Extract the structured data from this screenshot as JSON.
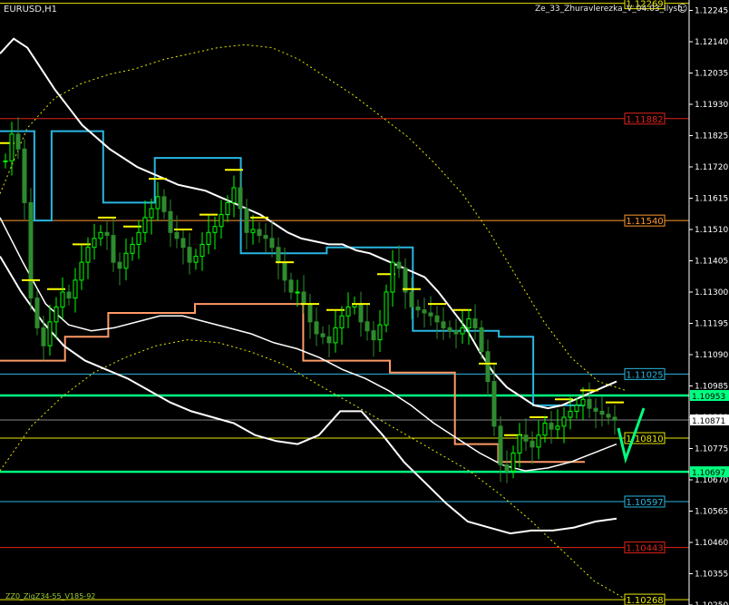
{
  "window": {
    "symbol_label": "EURUSD,H1",
    "indicator_label": "Ze_33_Zhuravlerezka_V_04.03_Ilysh",
    "smiley": "☺",
    "bottom_label": "ZZ0_ZigZ34-55_V185-92"
  },
  "colors": {
    "background": "#000000",
    "candle_up": "#00ff00",
    "candle_down": "#2e8b2e",
    "white_band": "#ffffff",
    "yellow_dash": "#e6e600",
    "cyan_step": "#29b6e0",
    "orange_step": "#ff9966",
    "yellow_bars": "#ffff00",
    "green_level": "#00ff80",
    "red_level": "#e0241a",
    "orange_level": "#ff9a2e",
    "blue_level": "#2f8fd8",
    "axis": "#ffffff"
  },
  "chart_data": {
    "type": "line",
    "title": "EURUSD,H1",
    "ylim": [
      1.1025,
      1.1228
    ],
    "y_ticks": [
      1.12245,
      1.1214,
      1.12035,
      1.1193,
      1.11825,
      1.1172,
      1.11615,
      1.1151,
      1.11405,
      1.113,
      1.11195,
      1.1109,
      1.10985,
      1.1088,
      1.10775,
      1.1067,
      1.10565,
      1.1046,
      1.10355,
      1.1025
    ],
    "current_price": 1.10871,
    "levels": [
      {
        "price": 1.12269,
        "color": "#e6e600",
        "label": "1.12269",
        "labeled": true
      },
      {
        "price": 1.11882,
        "color": "#e0241a",
        "label": "1.11882",
        "labeled": true
      },
      {
        "price": 1.1154,
        "color": "#ff9a2e",
        "label": "1.11540",
        "labeled": true
      },
      {
        "price": 1.11025,
        "color": "#29b6e0",
        "label": "1.11025",
        "labeled": true
      },
      {
        "price": 1.1081,
        "color": "#e6e600",
        "label": "1.10810",
        "labeled": true
      },
      {
        "price": 1.10597,
        "color": "#29b6e0",
        "label": "1.10597",
        "labeled": true
      },
      {
        "price": 1.10443,
        "color": "#e0241a",
        "label": "1.10443",
        "labeled": true
      },
      {
        "price": 1.10268,
        "color": "#e6e600",
        "label": "1.10268",
        "labeled": true
      },
      {
        "price": 1.10953,
        "color": "#00ff80",
        "label": "1.10953",
        "labeled": false,
        "axis_tag": true
      },
      {
        "price": 1.10697,
        "color": "#00ff80",
        "label": "1.10697",
        "labeled": false,
        "axis_tag": true
      }
    ],
    "candles_close": [
      1.1174,
      1.1183,
      1.1178,
      1.116,
      1.1128,
      1.1118,
      1.1112,
      1.112,
      1.1125,
      1.113,
      1.1128,
      1.1134,
      1.114,
      1.1145,
      1.1148,
      1.115,
      1.1149,
      1.114,
      1.1138,
      1.1143,
      1.1146,
      1.115,
      1.1155,
      1.1158,
      1.1162,
      1.1157,
      1.115,
      1.1148,
      1.1145,
      1.114,
      1.1142,
      1.1146,
      1.115,
      1.1152,
      1.1156,
      1.116,
      1.1165,
      1.1158,
      1.115,
      1.1151,
      1.1149,
      1.1148,
      1.1145,
      1.114,
      1.1134,
      1.113,
      1.113,
      1.1126,
      1.112,
      1.1116,
      1.1115,
      1.1113,
      1.1118,
      1.1122,
      1.1125,
      1.1126,
      1.112,
      1.1117,
      1.1114,
      1.1119,
      1.113,
      1.114,
      1.1138,
      1.113,
      1.1125,
      1.1124,
      1.1123,
      1.1122,
      1.112,
      1.1118,
      1.1117,
      1.1116,
      1.1118,
      1.1121,
      1.1118,
      1.111,
      1.11,
      1.1085,
      1.1072,
      1.107,
      1.1076,
      1.1082,
      1.108,
      1.1078,
      1.1082,
      1.1086,
      1.1084,
      1.1085,
      1.1088,
      1.109,
      1.1092,
      1.1094,
      1.1091,
      1.109,
      1.1089,
      1.1088,
      1.1087
    ],
    "white_upper": [
      1.121,
      1.1215,
      1.1212,
      1.1205,
      1.1198,
      1.1192,
      1.1186,
      1.1182,
      1.1178,
      1.1175,
      1.1172,
      1.117,
      1.1168,
      1.1166,
      1.1165,
      1.1164,
      1.1162,
      1.116,
      1.1158,
      1.1156,
      1.1153,
      1.115,
      1.1148,
      1.1147,
      1.1146,
      1.1146,
      1.1144,
      1.1143,
      1.1141,
      1.1139,
      1.1137,
      1.1135,
      1.113,
      1.1124,
      1.1118,
      1.111,
      1.1103,
      1.1098,
      1.1095,
      1.1092,
      1.1091,
      1.1092,
      1.1094,
      1.1096,
      1.1098,
      1.11
    ],
    "white_lower": [
      1.1142,
      1.113,
      1.112,
      1.1112,
      1.1107,
      1.1104,
      1.1101,
      1.1097,
      1.1093,
      1.109,
      1.1088,
      1.1086,
      1.1082,
      1.108,
      1.1079,
      1.1082,
      1.109,
      1.109,
      1.1082,
      1.1073,
      1.1066,
      1.1059,
      1.1053,
      1.1051,
      1.1049,
      1.105,
      1.105,
      1.1051,
      1.1053,
      1.1054
    ],
    "white_mid": [
      1.1155,
      1.114,
      1.1126,
      1.1119,
      1.1117,
      1.1118,
      1.112,
      1.1122,
      1.1122,
      1.112,
      1.1118,
      1.1116,
      1.1113,
      1.1111,
      1.1108,
      1.1104,
      1.1101,
      1.1097,
      1.1092,
      1.1086,
      1.1081,
      1.1076,
      1.1072,
      1.107,
      1.1071,
      1.1073,
      1.1076,
      1.1079
    ],
    "yellow_dash_upper": [
      1.1163,
      1.1185,
      1.1195,
      1.12,
      1.1203,
      1.1205,
      1.1208,
      1.121,
      1.1212,
      1.1213,
      1.1212,
      1.1208,
      1.1202,
      1.1196,
      1.1189,
      1.1182,
      1.1173,
      1.1163,
      1.115,
      1.1135,
      1.112,
      1.1108,
      1.11,
      1.1097
    ],
    "yellow_dash_lower": [
      1.107,
      1.1085,
      1.1095,
      1.1103,
      1.1108,
      1.1112,
      1.1114,
      1.1113,
      1.111,
      1.1106,
      1.11,
      1.1094,
      1.1088,
      1.1082,
      1.1076,
      1.107,
      1.1062,
      1.1053,
      1.1043,
      1.1033,
      1.1027
    ],
    "cyan_step": [
      1.1184,
      1.1184,
      1.1154,
      1.1184,
      1.1184,
      1.1184,
      1.116,
      1.116,
      1.116,
      1.1175,
      1.1175,
      1.1175,
      1.1175,
      1.1175,
      1.1143,
      1.1143,
      1.1143,
      1.1143,
      1.1143,
      1.1145,
      1.1145,
      1.1145,
      1.1145,
      1.1145,
      1.1117,
      1.1117,
      1.1117,
      1.1117,
      1.1117,
      1.1115,
      1.1115,
      1.1092,
      1.1092,
      1.1092
    ],
    "orange_step": [
      1.1107,
      1.1107,
      1.1107,
      1.1115,
      1.1115,
      1.1123,
      1.1123,
      1.1123,
      1.1123,
      1.1126,
      1.1126,
      1.1126,
      1.1126,
      1.1126,
      1.1107,
      1.1107,
      1.1107,
      1.1107,
      1.1103,
      1.1103,
      1.1103,
      1.1079,
      1.1079,
      1.1073,
      1.1073,
      1.1073,
      1.1073
    ]
  }
}
